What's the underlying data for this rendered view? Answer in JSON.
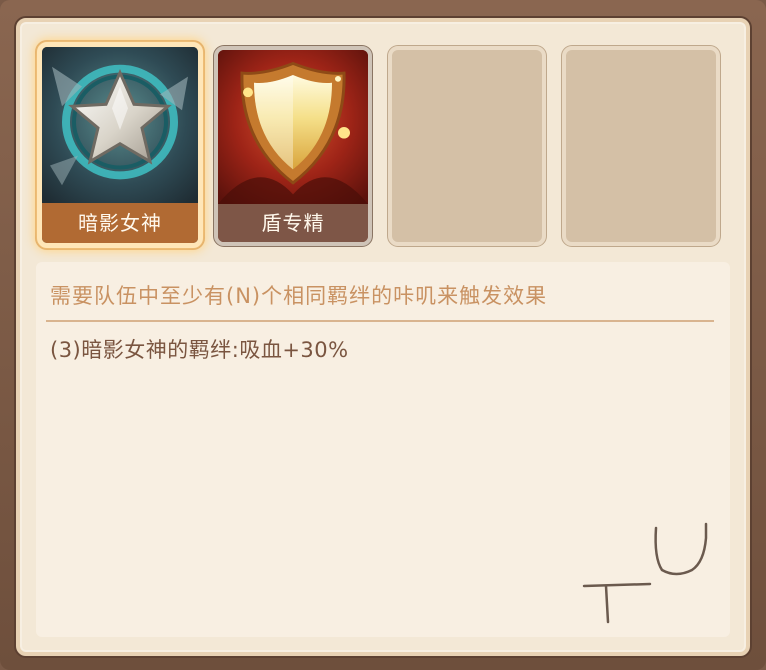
{
  "slots": [
    {
      "label": "暗影女神",
      "icon": "silver-star-emblem-icon",
      "selected": true
    },
    {
      "label": "盾专精",
      "icon": "golden-shield-icon",
      "selected": false
    },
    {
      "label": "",
      "icon": "",
      "selected": false
    },
    {
      "label": "",
      "icon": "",
      "selected": false
    }
  ],
  "description": {
    "header": "需要队伍中至少有(N)个相同羁绊的咔叽来触发效果",
    "bonus_line": "(3)暗影女神的羁绊:吸血+30%"
  },
  "colors": {
    "frame": "#7a5a47",
    "panel": "#f3e8d6",
    "header_text": "#c99262",
    "body_text": "#7a5540",
    "selected_label_bg": "#b16a33",
    "label_bg": "#7e5647"
  }
}
